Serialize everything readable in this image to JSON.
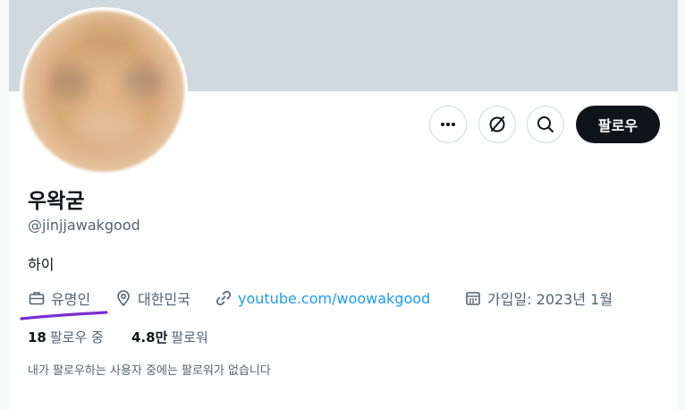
{
  "profile": {
    "display_name": "우왁굳",
    "handle": "@jinjjawakgood",
    "bio": "하이",
    "category": "유명인",
    "location": "대한민국",
    "website": "youtube.com/woowakgood",
    "joined": "가입일: 2023년 1월"
  },
  "actions": {
    "follow_label": "팔로우",
    "more_icon": "more-icon",
    "grok_icon": "grok-icon",
    "search_icon": "search-icon"
  },
  "stats": {
    "following_count": "18",
    "following_label": "팔로우 중",
    "followers_count": "4.8만",
    "followers_label": "팔로워"
  },
  "followers_note": "내가 팔로우하는 사용자 중에는 팔로워가 없습니다",
  "colors": {
    "banner": "#cfd9de",
    "link": "#1d9bf0",
    "secondary_text": "#536471",
    "primary_button": "#0f1419",
    "annotation_underline": "#7a2fd0"
  }
}
